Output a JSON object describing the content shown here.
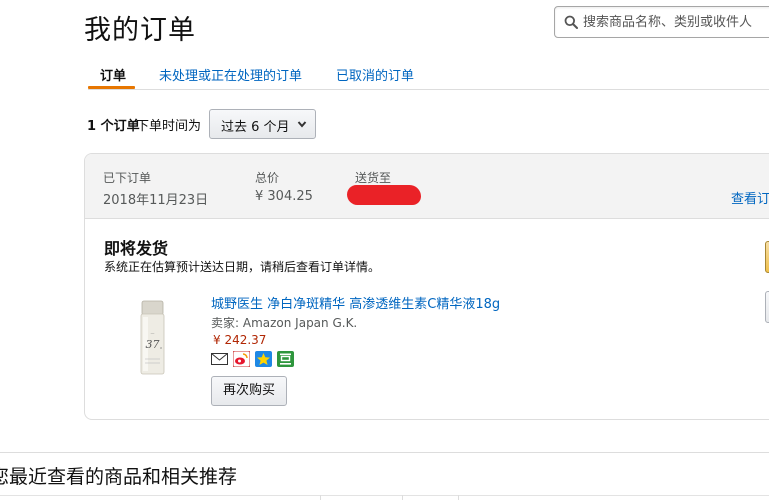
{
  "page": {
    "title": "我的订单"
  },
  "search": {
    "placeholder": "搜索商品名称、类别或收件人"
  },
  "tabs": [
    {
      "label": "订单",
      "active": true
    },
    {
      "label": "未处理或正在处理的订单",
      "active": false
    },
    {
      "label": "已取消的订单",
      "active": false
    }
  ],
  "filter": {
    "count_bold": "1 个订单",
    "label": "下单时间为",
    "selected": "过去 6 个月"
  },
  "order": {
    "placed_label": "已下订单",
    "placed_date": "2018年11月23日",
    "total_label": "总价",
    "total_value": "¥ 304.25",
    "ship_to_label": "送货至",
    "view_link": "查看订",
    "status_title": "即将发货",
    "status_desc": "系统正在估算预计送达日期，请稍后查看订单详情。",
    "item": {
      "name": "城野医生 净白净斑精华 高渗透维生素C精华液18g",
      "seller": "卖家: Amazon Japan G.K.",
      "price": "¥ 242.37",
      "share_icons": [
        "email-icon",
        "weibo-icon",
        "qzone-icon",
        "douban-icon"
      ],
      "rebuy_label": "再次购买"
    }
  },
  "recent": {
    "title": "您最近查看的商品和相关推荐"
  },
  "colors": {
    "link": "#0066c0",
    "price": "#b12704",
    "tab_accent": "#e77600",
    "redaction": "#ea2227"
  }
}
